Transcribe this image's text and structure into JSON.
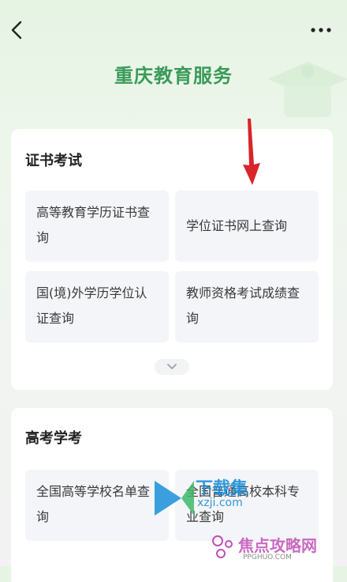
{
  "header": {
    "title": "重庆教育服务"
  },
  "sections": [
    {
      "title": "证书考试",
      "items": [
        {
          "label": "高等教育学历证书查询"
        },
        {
          "label": "学位证书网上查询"
        },
        {
          "label": "国(境)外学历学位认证查询"
        },
        {
          "label": "教师资格考试成绩查询"
        }
      ]
    },
    {
      "title": "高考学考",
      "items": [
        {
          "label": "全国高等学校名单查询"
        },
        {
          "label": "全国普通高校本科专业查询"
        }
      ]
    }
  ],
  "icons": {
    "back": "chevron-left-icon",
    "more": "more-dots-icon",
    "expand": "chevron-down-icon",
    "annotation": "red-arrow-icon"
  },
  "watermarks": {
    "site1_name": "下载集",
    "site1_domain": "xzji.com",
    "site2_name": "焦点攻略网",
    "site2_domain": "PPGHUO.COM"
  },
  "colors": {
    "title_green": "#3a9a5a",
    "annotation_red": "#d8242a"
  }
}
